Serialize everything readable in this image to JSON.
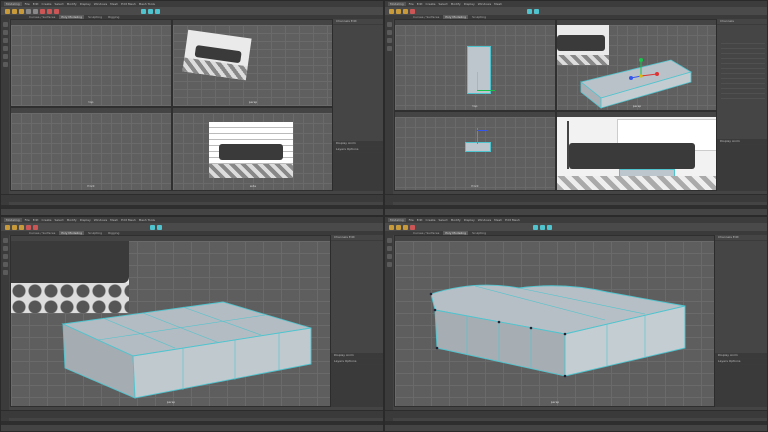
{
  "app": {
    "workspace": "Modeling",
    "menus": [
      "File",
      "Edit",
      "Create",
      "Select",
      "Modify",
      "Display",
      "Windows",
      "Mesh",
      "Edit Mesh",
      "Mesh Tools",
      "Mesh Display",
      "Curves",
      "Surfaces",
      "Deform",
      "UV",
      "Generate",
      "Cache",
      "Help"
    ],
    "shelf_tabs": [
      "Curves / Surfaces",
      "Poly Modeling",
      "Sculpting",
      "Rigging",
      "Animation",
      "Rendering",
      "FX",
      "FX Caching",
      "Custom",
      "Arnold",
      "Bifrost",
      "MASH",
      "Motion Graphics",
      "XGen"
    ],
    "active_shelf_tab": "Poly Modeling"
  },
  "panels": [
    {
      "id": "top-left",
      "viewports": [
        {
          "camera": "top"
        },
        {
          "camera": "persp"
        },
        {
          "camera": "front"
        },
        {
          "camera": "side"
        }
      ]
    },
    {
      "id": "top-right",
      "viewports": [
        {
          "camera": "top"
        },
        {
          "camera": "persp"
        },
        {
          "camera": "front"
        },
        {
          "camera": "side"
        }
      ]
    },
    {
      "id": "bottom-left",
      "viewports": [
        {
          "camera": "persp"
        }
      ]
    },
    {
      "id": "bottom-right",
      "viewports": [
        {
          "camera": "persp"
        }
      ]
    }
  ],
  "side_panel": {
    "tabs": [
      "Channels",
      "Edit",
      "Object",
      "Show"
    ],
    "layer_tabs": [
      "Display",
      "Anim"
    ],
    "layer_menu": [
      "Layers",
      "Options",
      "Help"
    ]
  },
  "colors": {
    "accent": "#4fc4cf",
    "viewport_bg": "#5f5f5f",
    "ui_dark": "#444444"
  }
}
